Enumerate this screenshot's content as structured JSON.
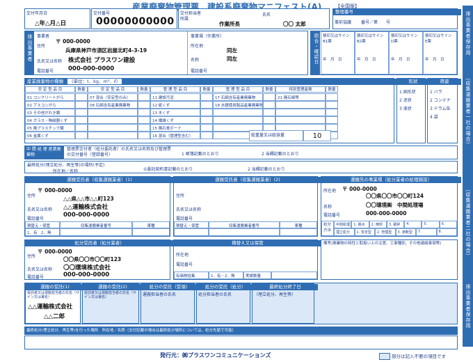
{
  "title": "産業廃棄物管理票　建設系廃棄物マニフェスト(A)",
  "edition": "【全国版】",
  "header": {
    "issue_date_label": "交付年月日",
    "issue_date_value": "△年△月△日",
    "issue_no_label": "交付番号",
    "issue_no_value": "00000000000",
    "person_label": "交付担当者",
    "dept_label": "所属",
    "dept_value": "作業所長",
    "name_label": "氏名",
    "name_value": "〇〇 太郎",
    "ref_label": "整理番号",
    "assoc_label": "事前協議",
    "assoc_value": "番号／第　　号",
    "year_label": "年　月　日号"
  },
  "discharger": {
    "side_label": "排出事業者",
    "business_label": "事業者",
    "address_label": "住所",
    "postal": "〒 000-0000",
    "address": "兵庫県神戸市須区岩屋北町4-3-19",
    "company_label": "氏名又は名称",
    "company": "株式会社 プラスワン建設",
    "phone_label": "電話番号",
    "phone": "000-000-0000",
    "site_label": "事業場（作業所）",
    "site_address_label": "所在地",
    "site_address": "同左",
    "site_name_label": "名称",
    "site_name": "同左",
    "site_phone_label": "電話番号"
  },
  "confirm": {
    "label": "照合・確認日",
    "cols": [
      "B1票",
      "B2票",
      "D票",
      "E票"
    ],
    "sig": "積印又はサイン",
    "date": "年　月　日"
  },
  "waste": {
    "header": "産業廃棄物の種類",
    "unit": "（単位：t．kg．m³．ℓ）",
    "groups": [
      "安 定 型 品 目",
      "数量",
      "安 定 型 品 目",
      "数量",
      "管 理 型 品 目",
      "数量",
      "管 理 型 品 目",
      "数量",
      "特別管理産廃",
      "数量"
    ],
    "col1": [
      "01 コンクリートがら",
      "02 アスコンがら",
      "03 その他がれき類",
      "04 ガラス・陶磁器くず",
      "05 廃プラスチック類",
      "06 金属くず"
    ],
    "col2": [
      "07 混合（安定型のみ）",
      "08 石綿含有産業廃棄物"
    ],
    "col3": [
      "11 建設汚泥",
      "12 紙くず",
      "13 木くず",
      "14 繊維くず",
      "15 廃石膏ボード",
      "16 混合（管理型含む）"
    ],
    "col4": [
      "17 石綿含有産業廃棄物",
      "18 水銀使用製品産業廃棄物"
    ],
    "col5": [
      "21 廃石綿等"
    ],
    "total_label": "総重量又は総容量",
    "total_value": "10",
    "shape_label": "形状",
    "shapes": [
      "1 固形状",
      "2 泥状",
      "3 液状"
    ],
    "pack_label": "荷姿",
    "packs": [
      "1 バラ",
      "2 コンテナ",
      "3 ドラム缶",
      "4 袋"
    ]
  },
  "middle": {
    "label": "中 間 処 理 産業廃棄物",
    "text": "管理票交付者（処分委託者）の氏名又は名称及び管理票の交付番号（登録番号）",
    "opt1": "1 帳簿記載のとおり",
    "opt2": "2 当欄記載のとおり"
  },
  "final": {
    "label": "最終処分(埋立処分、再生等)の場所(予定)",
    "addr_label": "所在地／名称",
    "opt1": "①委託契約書記載のとおり",
    "opt2": "2 当欄記載のとおり"
  },
  "transport1": {
    "header": "運搬受託者（収集運搬業者）(1)",
    "address_label": "住所",
    "postal": "〒 000-0000",
    "address": "△△県△△市△△町123",
    "company_label": "氏名又は名称",
    "company": "△△運輸株式会社",
    "phone_label": "電話番号",
    "phone": "000-000-0000",
    "cols": [
      "積替え・保管",
      "収集運搬業者番号",
      "車種"
    ],
    "opt": "1．有　2．無"
  },
  "transport2": {
    "header": "運搬受託者（収集運搬業者）(2)",
    "address_label": "住所",
    "company_label": "氏名又は名称",
    "phone_label": "電話番号",
    "cols": [
      "積替え・保管",
      "収集運搬業者番号",
      "車種"
    ]
  },
  "destination": {
    "header": "運搬先の事業場（処分業者の処理施設）",
    "address_label": "所在地",
    "postal": "〒 000-0000",
    "address": "〇〇県〇〇市〇〇町124",
    "name_label": "名称",
    "name": "〇〇環境㈱　中間処理場",
    "phone_label": "電話番号",
    "phone": "000-000-0000",
    "method_label": "処分方法",
    "methods_a": [
      "中間処理",
      "1. 脱水",
      "2. 焼却",
      "3. 破砕",
      "4.",
      "5.",
      "6."
    ],
    "methods_b": [
      "埋立処分",
      "1. 安定型",
      "2. 管理型",
      "3. 遮断型",
      "7.",
      "8."
    ]
  },
  "disposal": {
    "header": "処分受託者（処分業者）",
    "address_label": "住所",
    "postal": "〒 000-0000",
    "address": "〇〇県〇〇市〇〇町123",
    "company_label": "氏名又は名称",
    "company": "〇〇環境株式会社",
    "phone_label": "電話番号",
    "phone": "000-000-0000"
  },
  "storage": {
    "header": "積替え又は保管",
    "addr_label": "所在地",
    "phone_label": "電話番号",
    "valuable_label": "有価物拾集",
    "opt": "1．有・2．無",
    "qty_label": "実績数量"
  },
  "remarks": {
    "label": "備考",
    "text": "備考(廃棄物の特性と取扱い上の注意、工事種別、その他連絡事項等)"
  },
  "receipts": [
    {
      "label": "運搬の受託(1)",
      "sub": "受託者又は運搬担当者の氏名（サイン又は署名）",
      "company": "△△運輸株式会社",
      "person": "△△二郎"
    },
    {
      "label": "運搬の受託(2)",
      "sub": "受託者又は運搬担当者の氏名（サイン又は署名）",
      "company": "",
      "person": ""
    },
    {
      "label": "処分の受託（受領）",
      "sub": "運搬担当者の氏名",
      "company": "",
      "person": ""
    },
    {
      "label": "処分の受託（処分）",
      "sub": "処分担当者の氏名",
      "company": "",
      "person": ""
    },
    {
      "label": "最終処分終了日",
      "sub": "（埋立処分、再生等）",
      "company": "",
      "person": ""
    }
  ],
  "final_note": "最終処分(埋立処分、再生等)を行った場所　所在地／名称（交付記載の場合は最終処分場所については、処分先届で可能）",
  "footer": {
    "publisher": "発行元：㈱プラスワンコミュニケーションズ",
    "note": "部分は記入不要の項目です"
  },
  "side_texts": [
    "排出事業者保存用",
    "（収集運搬業者一社の場合）",
    "（収集運搬業者二社の場合）",
    "排出事業者保存用"
  ],
  "colors": {
    "primary": "#2f6db3",
    "light": "#dbe8f7"
  }
}
